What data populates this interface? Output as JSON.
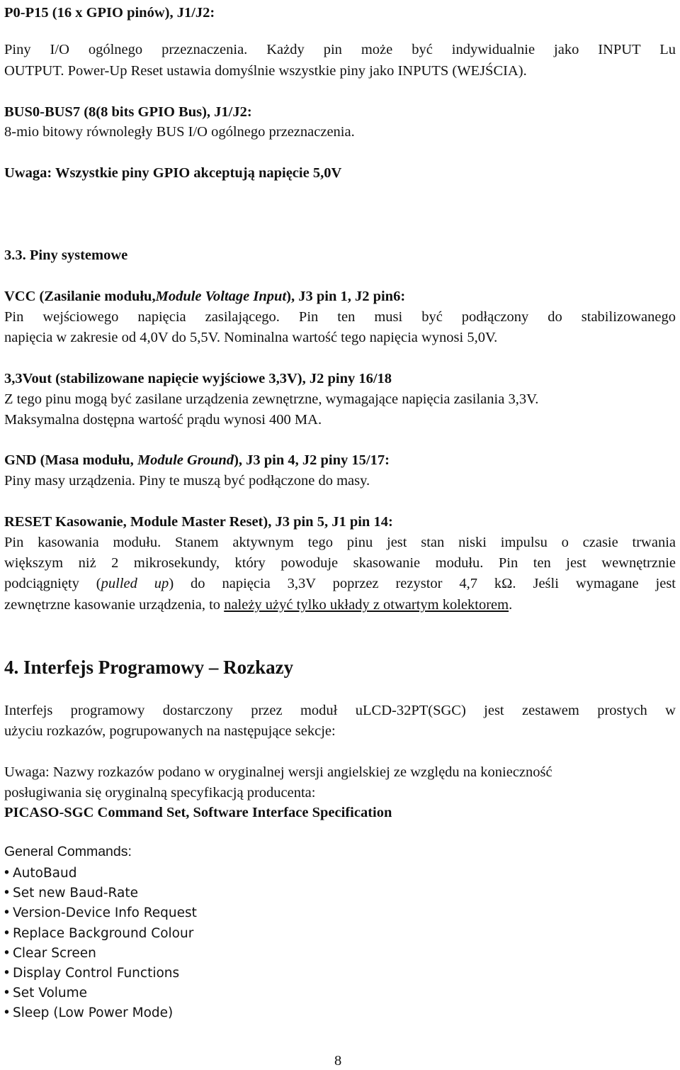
{
  "gpio": {
    "heading": "P0-P15 (16 x GPIO pinów), J1/J2:",
    "para_line1": "Piny I/O ogólnego przeznaczenia. Każdy pin może być indywidualnie jako INPUT Lu",
    "para_line2": "OUTPUT. Power-Up Reset ustawia domyślnie wszystkie piny jako INPUTS (WEJŚCIA)."
  },
  "bus": {
    "heading": "BUS0-BUS7 (8(8 bits GPIO Bus), J1/J2:",
    "para": "8-mio bitowy równoległy BUS I/O ogólnego przeznaczenia."
  },
  "note_gpio": "Uwaga: Wszystkie piny GPIO akceptują napięcie 5,0V",
  "section_33": {
    "title": "3.3. Piny systemowe",
    "vcc": {
      "heading_a": "VCC (Zasilanie modułu,",
      "heading_italic": "Module Voltage Input",
      "heading_b": "),  J3 pin 1, J2 pin6:",
      "line1": "Pin wejściowego napięcia zasilającego. Pin ten musi być podłączony do stabilizowanego",
      "line2": "napięcia w zakresie od 4,0V do 5,5V. Nominalna wartość tego napięcia wynosi 5,0V."
    },
    "vout": {
      "heading": "3,3Vout (stabilizowane napięcie wyjściowe 3,3V), J2 piny 16/18",
      "line1": "Z tego pinu mogą być zasilane urządzenia zewnętrzne, wymagające napięcia zasilania 3,3V.",
      "line2": "Maksymalna dostępna wartość prądu wynosi 400 MA."
    },
    "gnd": {
      "heading_a": "GND (Masa modułu, ",
      "heading_italic": "Module Ground",
      "heading_b": "), J3 pin 4, J2 piny 15/17:",
      "line1": "Piny masy urządzenia. Piny te muszą być podłączone do masy."
    },
    "reset": {
      "heading": "RESET Kasowanie, Module Master Reset), J3 pin 5, J1 pin 14:",
      "line1": "Pin kasowania modułu. Stanem aktywnym tego pinu jest stan niski impulsu o czasie trwania",
      "line2": "większym niż 2 mikrosekundy, który powoduje skasowanie modułu. Pin ten jest wewnętrznie",
      "line3_a": "podciągnięty (",
      "line3_italic": "pulled up",
      "line3_b": ") do napięcia 3,3V poprzez rezystor 4,7 kΩ. Jeśli wymagane jest",
      "line4_a": "zewnętrzne kasowanie urządzenia, to ",
      "line4_underlined": "należy użyć tylko układy z otwartym kolektorem",
      "line4_b": "."
    }
  },
  "section_4": {
    "title": "4. Interfejs Programowy – Rozkazy",
    "intro_line1": "Interfejs programowy dostarczony przez moduł uLCD-32PT(SGC) jest zestawem prostych w",
    "intro_line2": "użyciu rozkazów, pogrupowanych na następujące sekcje:",
    "note_line1": "Uwaga: Nazwy rozkazów podano w oryginalnej wersji angielskiej ze względu na konieczność",
    "note_line2": "posługiwania się oryginalną specyfikacją producenta:",
    "spec_title": "PICASO-SGC Command Set, Software Interface Specification"
  },
  "general_commands": {
    "title": "General Commands:",
    "bullet": "•",
    "items": [
      "AutoBaud",
      "Set new Baud-Rate",
      "Version-Device Info Request",
      "Replace Background Colour",
      "Clear Screen",
      "Display Control Functions",
      "Set Volume",
      "Sleep (Low Power Mode)"
    ]
  },
  "page_number": "8"
}
